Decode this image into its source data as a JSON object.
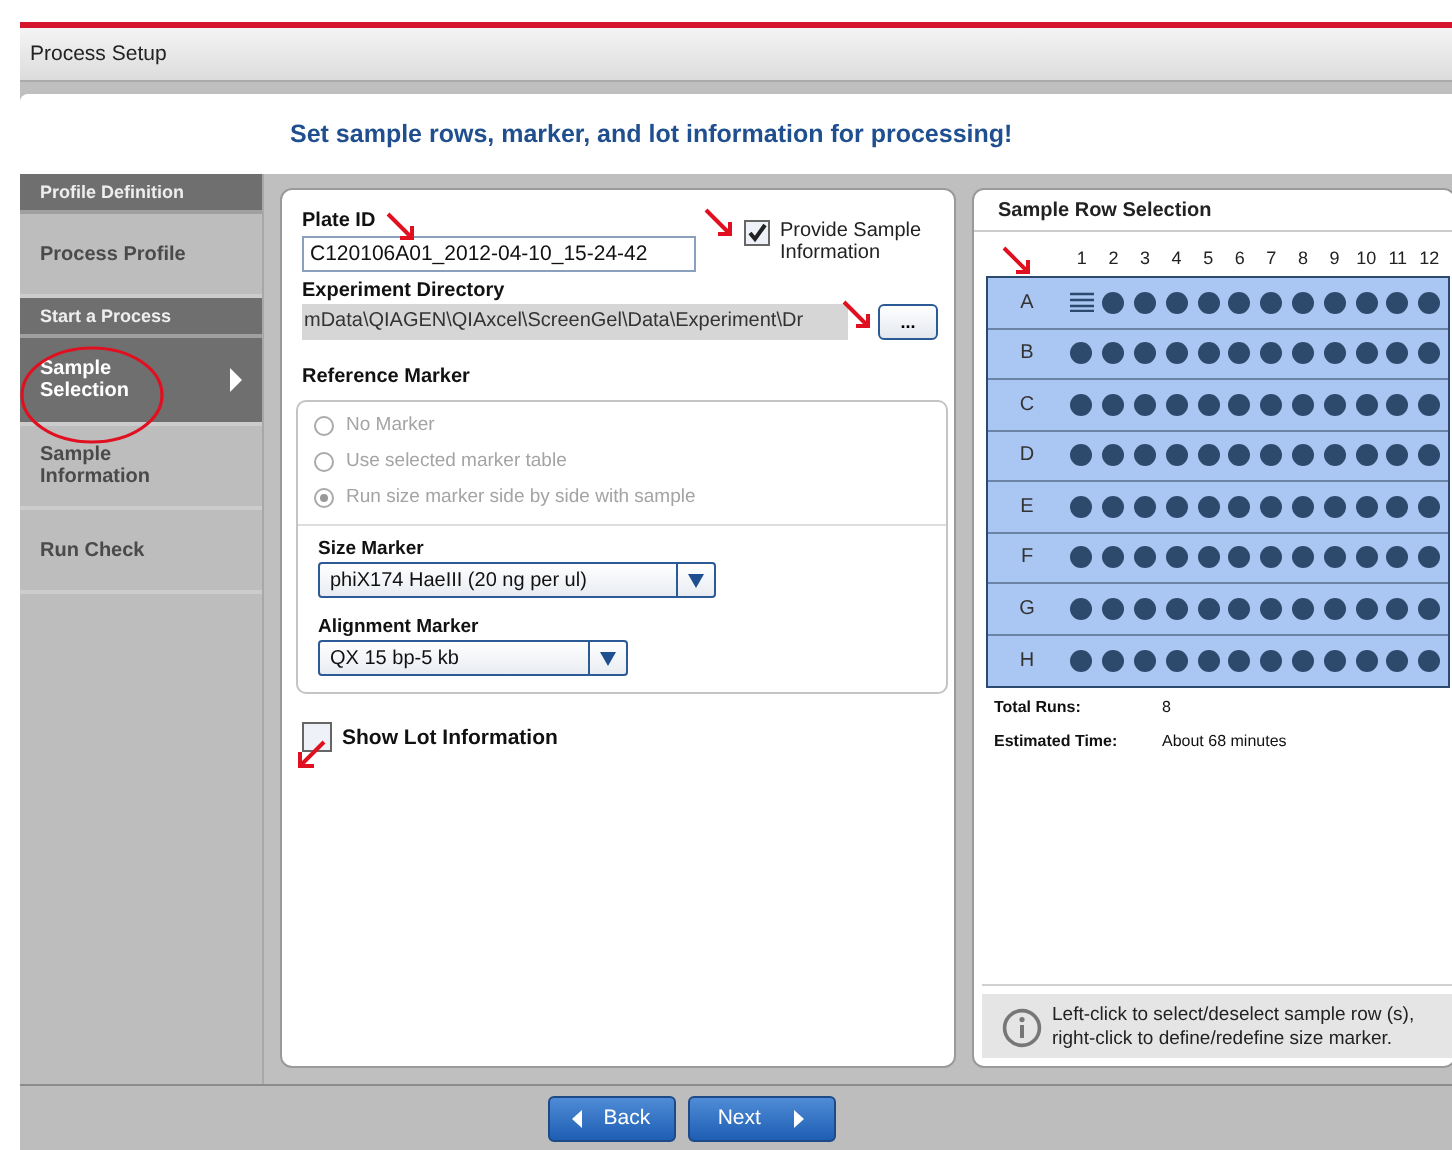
{
  "window": {
    "title": "Process Setup"
  },
  "heading": "Set sample rows, marker, and lot information for processing!",
  "sidebar": {
    "items": [
      {
        "kind": "header",
        "label": "Profile Definition"
      },
      {
        "kind": "item",
        "label": "Process Profile",
        "selected": false
      },
      {
        "kind": "header",
        "label": "Start a Process"
      },
      {
        "kind": "item",
        "label": "Sample Selection",
        "selected": true
      },
      {
        "kind": "item",
        "label": "Sample Information",
        "selected": false
      },
      {
        "kind": "item",
        "label": "Run Check",
        "selected": false
      }
    ]
  },
  "plate_id": {
    "label": "Plate ID",
    "value": "C120106A01_2012-04-10_15-24-42"
  },
  "provide_sample_information": {
    "label": "Provide Sample Information",
    "checked": true
  },
  "experiment_directory": {
    "label": "Experiment Directory",
    "value": "mData\\QIAGEN\\QIAxcel\\ScreenGel\\Data\\Experiment\\Dr",
    "browse_button": "..."
  },
  "reference_marker": {
    "label": "Reference Marker",
    "options": [
      {
        "label": "No Marker",
        "selected": false,
        "disabled": true
      },
      {
        "label": "Use selected marker table",
        "selected": false,
        "disabled": true
      },
      {
        "label": "Run size marker side by side with sample",
        "selected": true,
        "disabled": true
      }
    ]
  },
  "size_marker": {
    "label": "Size Marker",
    "value": "phiX174 HaeIII (20 ng per ul)"
  },
  "alignment_marker": {
    "label": "Alignment Marker",
    "value": "QX 15 bp-5 kb"
  },
  "show_lot_information": {
    "label": "Show Lot Information",
    "checked": false
  },
  "sample_row_selection": {
    "title": "Sample Row Selection",
    "columns": [
      "1",
      "2",
      "3",
      "4",
      "5",
      "6",
      "7",
      "8",
      "9",
      "10",
      "11",
      "12"
    ],
    "rows": [
      {
        "label": "A",
        "selected": true,
        "marker_well": true
      },
      {
        "label": "B",
        "selected": true,
        "marker_well": false
      },
      {
        "label": "C",
        "selected": true,
        "marker_well": false
      },
      {
        "label": "D",
        "selected": true,
        "marker_well": false
      },
      {
        "label": "E",
        "selected": true,
        "marker_well": false
      },
      {
        "label": "F",
        "selected": true,
        "marker_well": false
      },
      {
        "label": "G",
        "selected": true,
        "marker_well": false
      },
      {
        "label": "H",
        "selected": true,
        "marker_well": false
      }
    ],
    "summary": [
      {
        "label": "Total Runs:",
        "value": "8"
      },
      {
        "label": "Estimated Time:",
        "value": "About 68 minutes"
      }
    ],
    "hint": "Left-click to select/deselect sample row (s), right-click to define/redefine size marker."
  },
  "buttons": [
    {
      "kind": "back",
      "label": "Back"
    },
    {
      "kind": "next",
      "label": "Next"
    }
  ]
}
